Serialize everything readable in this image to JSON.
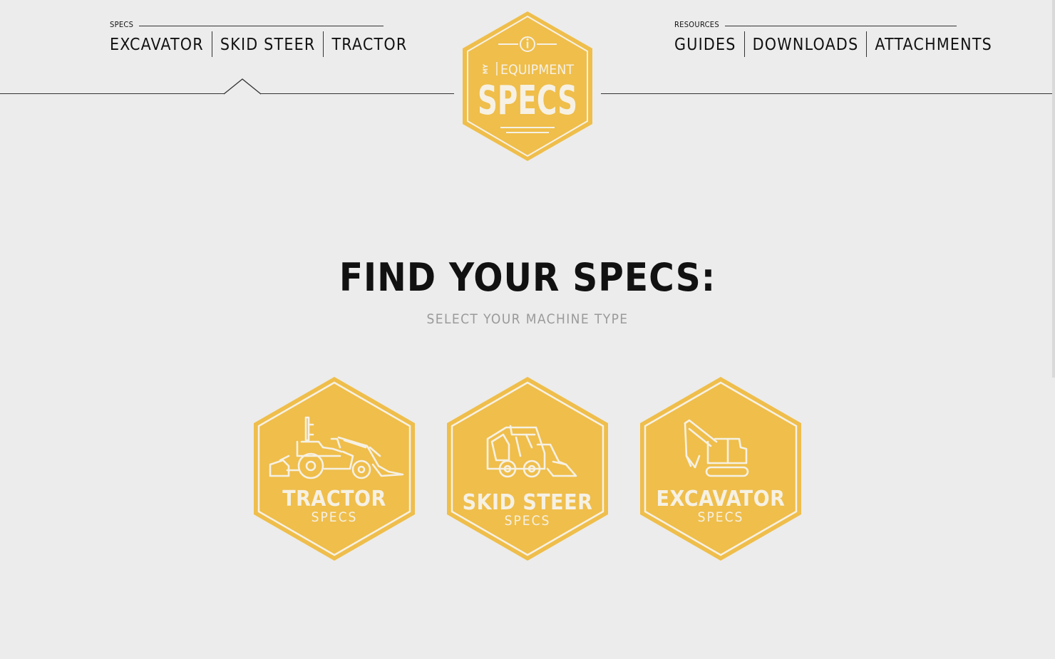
{
  "nav_left": {
    "caption": "SPECS",
    "items": [
      "EXCAVATOR",
      "SKID STEER",
      "TRACTOR"
    ]
  },
  "nav_right": {
    "caption": "RESOURCES",
    "items": [
      "GUIDES",
      "DOWNLOADS",
      "ATTACHMENTS"
    ]
  },
  "logo": {
    "my": "MY",
    "equipment": "EQUIPMENT",
    "specs": "SPECS",
    "icon": "info-icon"
  },
  "main": {
    "headline": "FIND YOUR SPECS:",
    "subhead": "SELECT YOUR MACHINE TYPE"
  },
  "cards": [
    {
      "title": "TRACTOR",
      "sub": "SPECS",
      "icon": "tractor-icon"
    },
    {
      "title": "SKID STEER",
      "sub": "SPECS",
      "icon": "skid-steer-icon"
    },
    {
      "title": "EXCAVATOR",
      "sub": "SPECS",
      "icon": "excavator-icon"
    }
  ],
  "colors": {
    "background": "#ececec",
    "accent": "#efbe4b",
    "card_text": "#f6f1e4",
    "subhead": "#9a9a9a"
  }
}
